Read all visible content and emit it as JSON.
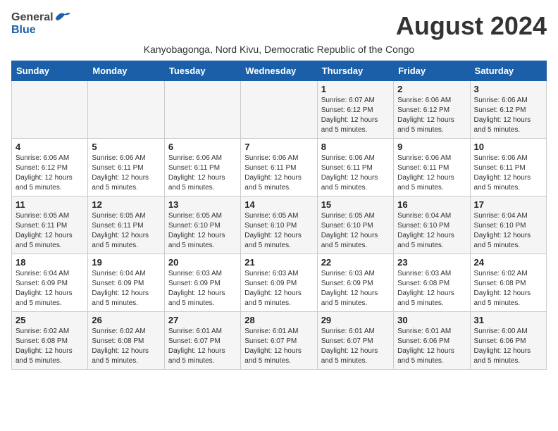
{
  "header": {
    "logo_general": "General",
    "logo_blue": "Blue",
    "month_title": "August 2024",
    "subtitle": "Kanyobagonga, Nord Kivu, Democratic Republic of the Congo"
  },
  "weekdays": [
    "Sunday",
    "Monday",
    "Tuesday",
    "Wednesday",
    "Thursday",
    "Friday",
    "Saturday"
  ],
  "weeks": [
    [
      {
        "day": "",
        "info": ""
      },
      {
        "day": "",
        "info": ""
      },
      {
        "day": "",
        "info": ""
      },
      {
        "day": "",
        "info": ""
      },
      {
        "day": "1",
        "info": "Sunrise: 6:07 AM\nSunset: 6:12 PM\nDaylight: 12 hours\nand 5 minutes."
      },
      {
        "day": "2",
        "info": "Sunrise: 6:06 AM\nSunset: 6:12 PM\nDaylight: 12 hours\nand 5 minutes."
      },
      {
        "day": "3",
        "info": "Sunrise: 6:06 AM\nSunset: 6:12 PM\nDaylight: 12 hours\nand 5 minutes."
      }
    ],
    [
      {
        "day": "4",
        "info": "Sunrise: 6:06 AM\nSunset: 6:12 PM\nDaylight: 12 hours\nand 5 minutes."
      },
      {
        "day": "5",
        "info": "Sunrise: 6:06 AM\nSunset: 6:11 PM\nDaylight: 12 hours\nand 5 minutes."
      },
      {
        "day": "6",
        "info": "Sunrise: 6:06 AM\nSunset: 6:11 PM\nDaylight: 12 hours\nand 5 minutes."
      },
      {
        "day": "7",
        "info": "Sunrise: 6:06 AM\nSunset: 6:11 PM\nDaylight: 12 hours\nand 5 minutes."
      },
      {
        "day": "8",
        "info": "Sunrise: 6:06 AM\nSunset: 6:11 PM\nDaylight: 12 hours\nand 5 minutes."
      },
      {
        "day": "9",
        "info": "Sunrise: 6:06 AM\nSunset: 6:11 PM\nDaylight: 12 hours\nand 5 minutes."
      },
      {
        "day": "10",
        "info": "Sunrise: 6:06 AM\nSunset: 6:11 PM\nDaylight: 12 hours\nand 5 minutes."
      }
    ],
    [
      {
        "day": "11",
        "info": "Sunrise: 6:05 AM\nSunset: 6:11 PM\nDaylight: 12 hours\nand 5 minutes."
      },
      {
        "day": "12",
        "info": "Sunrise: 6:05 AM\nSunset: 6:11 PM\nDaylight: 12 hours\nand 5 minutes."
      },
      {
        "day": "13",
        "info": "Sunrise: 6:05 AM\nSunset: 6:10 PM\nDaylight: 12 hours\nand 5 minutes."
      },
      {
        "day": "14",
        "info": "Sunrise: 6:05 AM\nSunset: 6:10 PM\nDaylight: 12 hours\nand 5 minutes."
      },
      {
        "day": "15",
        "info": "Sunrise: 6:05 AM\nSunset: 6:10 PM\nDaylight: 12 hours\nand 5 minutes."
      },
      {
        "day": "16",
        "info": "Sunrise: 6:04 AM\nSunset: 6:10 PM\nDaylight: 12 hours\nand 5 minutes."
      },
      {
        "day": "17",
        "info": "Sunrise: 6:04 AM\nSunset: 6:10 PM\nDaylight: 12 hours\nand 5 minutes."
      }
    ],
    [
      {
        "day": "18",
        "info": "Sunrise: 6:04 AM\nSunset: 6:09 PM\nDaylight: 12 hours\nand 5 minutes."
      },
      {
        "day": "19",
        "info": "Sunrise: 6:04 AM\nSunset: 6:09 PM\nDaylight: 12 hours\nand 5 minutes."
      },
      {
        "day": "20",
        "info": "Sunrise: 6:03 AM\nSunset: 6:09 PM\nDaylight: 12 hours\nand 5 minutes."
      },
      {
        "day": "21",
        "info": "Sunrise: 6:03 AM\nSunset: 6:09 PM\nDaylight: 12 hours\nand 5 minutes."
      },
      {
        "day": "22",
        "info": "Sunrise: 6:03 AM\nSunset: 6:09 PM\nDaylight: 12 hours\nand 5 minutes."
      },
      {
        "day": "23",
        "info": "Sunrise: 6:03 AM\nSunset: 6:08 PM\nDaylight: 12 hours\nand 5 minutes."
      },
      {
        "day": "24",
        "info": "Sunrise: 6:02 AM\nSunset: 6:08 PM\nDaylight: 12 hours\nand 5 minutes."
      }
    ],
    [
      {
        "day": "25",
        "info": "Sunrise: 6:02 AM\nSunset: 6:08 PM\nDaylight: 12 hours\nand 5 minutes."
      },
      {
        "day": "26",
        "info": "Sunrise: 6:02 AM\nSunset: 6:08 PM\nDaylight: 12 hours\nand 5 minutes."
      },
      {
        "day": "27",
        "info": "Sunrise: 6:01 AM\nSunset: 6:07 PM\nDaylight: 12 hours\nand 5 minutes."
      },
      {
        "day": "28",
        "info": "Sunrise: 6:01 AM\nSunset: 6:07 PM\nDaylight: 12 hours\nand 5 minutes."
      },
      {
        "day": "29",
        "info": "Sunrise: 6:01 AM\nSunset: 6:07 PM\nDaylight: 12 hours\nand 5 minutes."
      },
      {
        "day": "30",
        "info": "Sunrise: 6:01 AM\nSunset: 6:06 PM\nDaylight: 12 hours\nand 5 minutes."
      },
      {
        "day": "31",
        "info": "Sunrise: 6:00 AM\nSunset: 6:06 PM\nDaylight: 12 hours\nand 5 minutes."
      }
    ]
  ],
  "alt_weeks": [
    0,
    2,
    4
  ]
}
